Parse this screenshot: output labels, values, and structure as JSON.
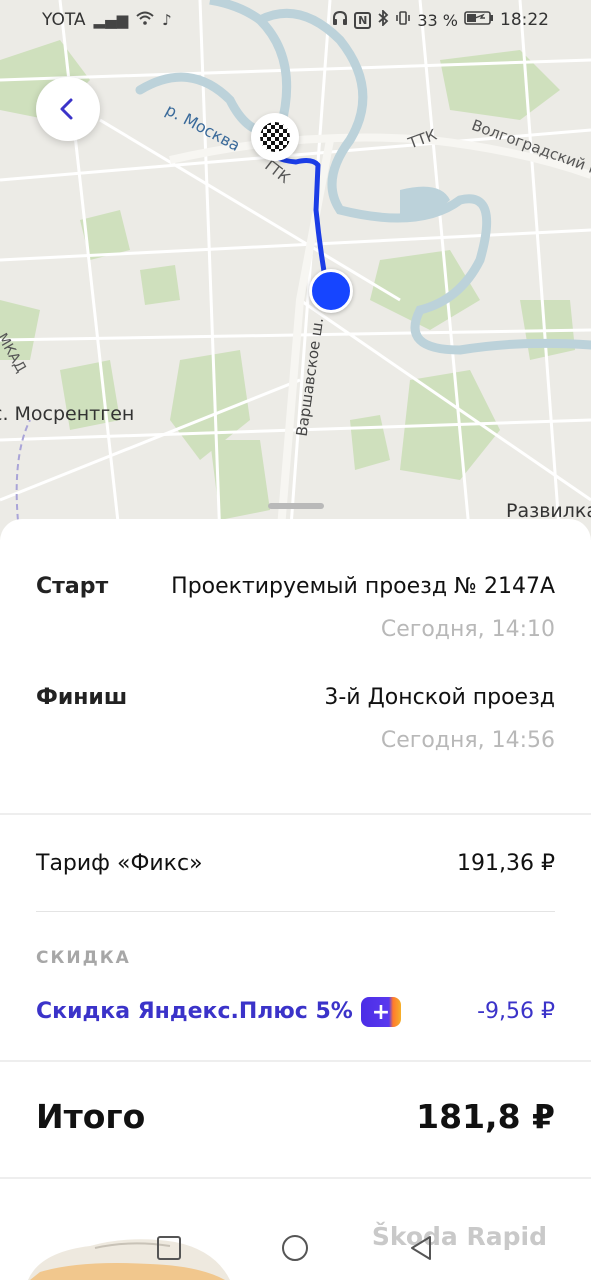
{
  "status_bar": {
    "carrier": "YOTA",
    "battery": "33 %",
    "time": "18:22"
  },
  "map": {
    "labels": {
      "river": "р. Москва",
      "ttk_left": "ТТК",
      "ttk_right": "ТТК",
      "volgograd": "Волгоградский пр",
      "mosrentgen": "с. Мосрентген",
      "varshavskoe": "Варшавское ш.",
      "razvilka": "Развилка",
      "mkad": "МКАД"
    },
    "colors": {
      "route": "#1b3de6",
      "start_dot": "#1645ff",
      "water": "#c7d7de",
      "green": "#cfe2bd"
    }
  },
  "route": {
    "start_label": "Старт",
    "start_address": "Проектируемый проезд № 2147А",
    "start_time": "Сегодня, 14:10",
    "finish_label": "Финиш",
    "finish_address": "3-й Донской проезд",
    "finish_time": "Сегодня, 14:56"
  },
  "price": {
    "tariff_label": "Тариф «Фикс»",
    "tariff_amount": "191,36 ₽",
    "discount_caption": "СКИДКА",
    "discount_label": "Скидка Яндекс.Плюс 5%",
    "plus_badge": "+",
    "discount_amount": "-9,56 ₽",
    "total_label": "Итого",
    "total_amount": "181,8 ₽"
  },
  "promo": {
    "car_name": "Škoda Rapid"
  },
  "nav_bar": {
    "icons": [
      "square-icon",
      "circle-icon",
      "triangle-back-icon"
    ]
  }
}
